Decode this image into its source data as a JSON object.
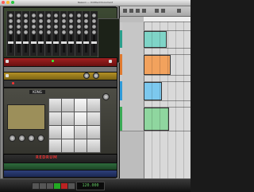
{
  "window": {
    "title": "Reason — Untitled Document",
    "buttons": [
      "close",
      "minimize",
      "zoom"
    ],
    "button_colors": [
      "#ff5f57",
      "#febc2e",
      "#28c840"
    ]
  },
  "rack": {
    "mixer": {
      "channel_count": 12
    },
    "devices": [
      {
        "id": "reverb",
        "color": "#a02020"
      },
      {
        "id": "line",
        "color": "#777777"
      },
      {
        "id": "compressor",
        "color": "#b39025"
      },
      {
        "id": "utility",
        "color": "#3a3a3a"
      }
    ],
    "kong": {
      "logo": "KONG",
      "pads": 16,
      "active_pads": [
        2,
        6,
        9
      ]
    },
    "redrum": {
      "logo": "REDRUM"
    },
    "extra_units": [
      {
        "id": "green-unit",
        "color": "#2e6b3c"
      },
      {
        "id": "blue-unit",
        "color": "#2d3f7a"
      }
    ]
  },
  "transport": {
    "tempo": "120.000",
    "buttons": [
      "rewind",
      "fast-forward",
      "stop",
      "play",
      "record",
      "loop"
    ]
  },
  "sequencer": {
    "tracks": [
      {
        "color": "#c9c9c9",
        "clip": null
      },
      {
        "color": "#2aa08c",
        "clip": {
          "color": "#7fd4c7",
          "span": [
            0.0,
            0.45
          ]
        }
      },
      {
        "color": "#c9c9c9",
        "clip": null
      },
      {
        "color": "#e07a2f",
        "clip": {
          "color": "#f2a25d",
          "span": [
            0.0,
            0.55
          ]
        }
      },
      {
        "color": "#c9c9c9",
        "clip": null
      },
      {
        "color": "#2f9bd9",
        "clip": {
          "color": "#7cc8ee",
          "span": [
            0.0,
            0.35
          ]
        }
      },
      {
        "color": "#c9c9c9",
        "clip": null
      },
      {
        "color": "#3aaa55",
        "clip": {
          "color": "#8fd69f",
          "span": [
            0.0,
            0.5
          ]
        }
      }
    ]
  }
}
